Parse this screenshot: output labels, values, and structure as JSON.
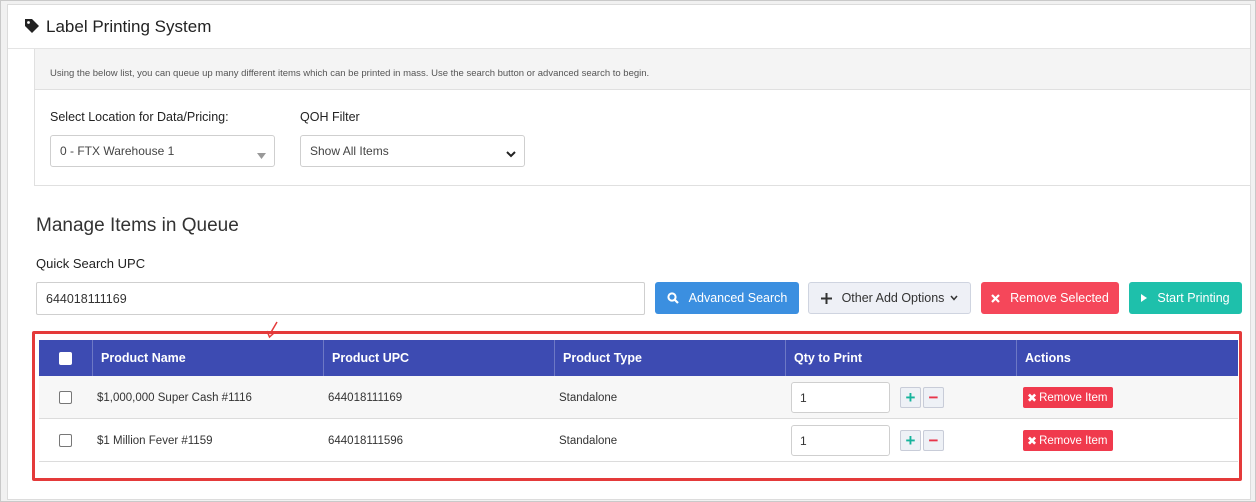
{
  "app": {
    "title": "Label Printing System",
    "icon": "tag-icon"
  },
  "panel": {
    "description": "Using the below list, you can queue up many different items which can be printed in mass. Use the search button or advanced search to begin.",
    "location_label": "Select Location for Data/Pricing:",
    "location_value": "0 - FTX Warehouse 1",
    "qoh_label": "QOH Filter",
    "qoh_value": "Show All Items"
  },
  "queue": {
    "title": "Manage Items in Queue",
    "quick_search_label": "Quick Search UPC",
    "quick_search_value": "644018111169"
  },
  "toolbar": {
    "advanced_search": "Advanced Search",
    "other_add_options": "Other Add Options",
    "remove_selected": "Remove Selected",
    "start_printing": "Start Printing"
  },
  "table": {
    "headers": [
      "Product Name",
      "Product UPC",
      "Product Type",
      "Qty to Print",
      "Actions"
    ],
    "rows": [
      {
        "name": "$1,000,000 Super Cash #1116",
        "upc": "644018111169",
        "type": "Standalone",
        "qty": "1",
        "action": "Remove Item"
      },
      {
        "name": "$1 Million Fever #1159",
        "upc": "644018111596",
        "type": "Standalone",
        "qty": "1",
        "action": "Remove Item"
      }
    ]
  },
  "colors": {
    "table_header": "#3d4bb2",
    "highlight_border": "#e43a3a",
    "primary": "#3b8fe0",
    "danger": "#f5475a",
    "success": "#1ec0ab"
  }
}
